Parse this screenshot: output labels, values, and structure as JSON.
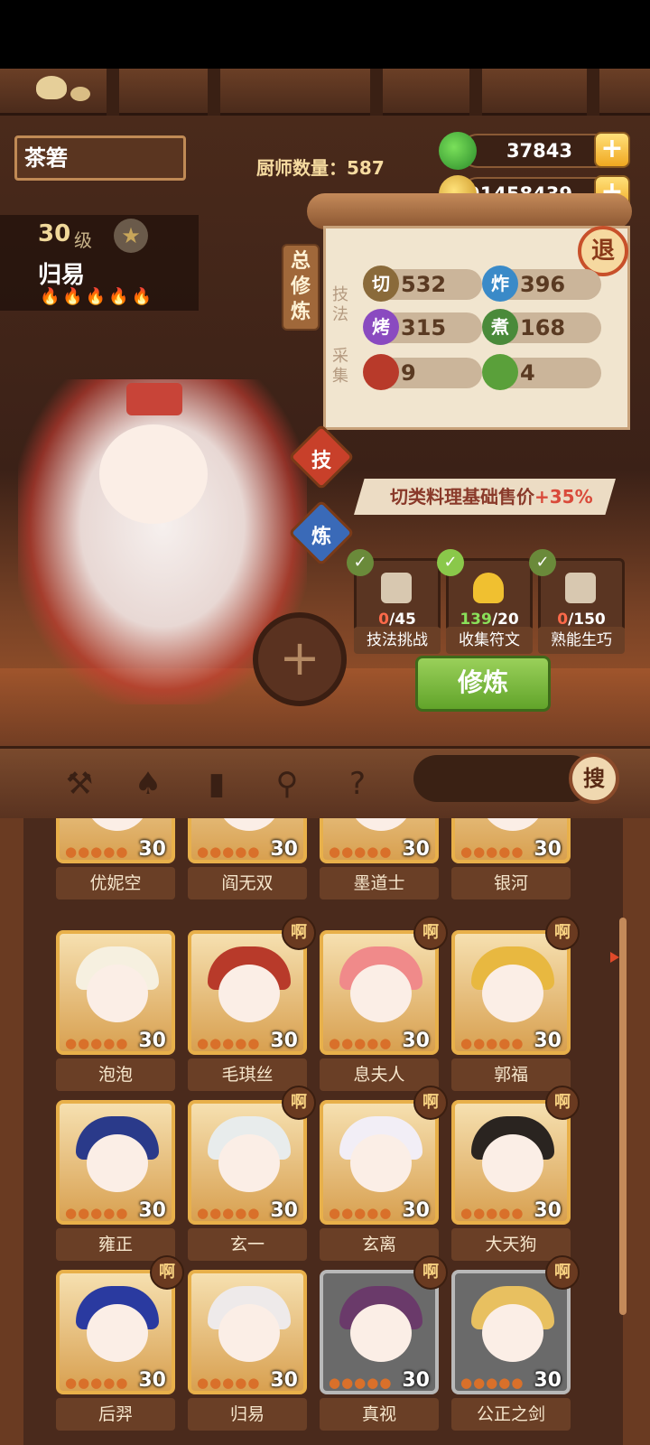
{
  "header": {
    "kitchen_name": "茶箬",
    "chef_count_label": "厨师数量：",
    "chef_count": "587"
  },
  "currency": {
    "jade": "37843",
    "gold": "91458439",
    "plus_glyph": "+"
  },
  "character": {
    "level": "30",
    "level_unit": "级",
    "name": "归易",
    "star_glyph": "★",
    "flames": "🔥🔥🔥🔥🔥"
  },
  "cultivation": {
    "tab_label": "总修炼",
    "back_label": "退",
    "technique_label": "技法",
    "gather_label": "采集",
    "stats": [
      {
        "icon": "切",
        "value": "532",
        "color": "#8a6a3a"
      },
      {
        "icon": "炸",
        "value": "396",
        "color": "#3a8ac8"
      },
      {
        "icon": "烤",
        "value": "315",
        "color": "#8a4ac0"
      },
      {
        "icon": "煮",
        "value": "168",
        "color": "#4a8a3a"
      },
      {
        "icon": "",
        "value": "9",
        "color": "#b83a2a"
      },
      {
        "icon": "",
        "value": "4",
        "color": "#5aa03a"
      }
    ],
    "skill_tab": "技",
    "refine_tab": "炼",
    "bonus_text": "切类料理基础售价",
    "bonus_value": "+35%",
    "tasks": [
      {
        "count": "0",
        "total": "/45",
        "label": "技法挑战",
        "check": "✓"
      },
      {
        "count": "139",
        "total": "/20",
        "label": "收集符文",
        "check": "✓"
      },
      {
        "count": "0",
        "total": "/150",
        "label": "熟能生巧",
        "check": "✓"
      }
    ],
    "cultivate_button": "修炼",
    "add_glyph": "+"
  },
  "toolbar": {
    "search_label": "搜"
  },
  "badge_label": "啊",
  "chefs": [
    {
      "name": "优妮空",
      "level": "30",
      "hair": "#f4b8b0",
      "badge": false,
      "frame": "gold"
    },
    {
      "name": "阎无双",
      "level": "30",
      "hair": "#3ab0b8",
      "badge": false,
      "frame": "gold"
    },
    {
      "name": "墨道士",
      "level": "30",
      "hair": "#b8b0c8",
      "badge": false,
      "frame": "gold"
    },
    {
      "name": "银河",
      "level": "30",
      "hair": "#2a2040",
      "badge": false,
      "frame": "gold"
    },
    {
      "name": "泡泡",
      "level": "30",
      "hair": "#f6f0e0",
      "badge": false,
      "frame": "gold"
    },
    {
      "name": "毛琪丝",
      "level": "30",
      "hair": "#b83a2a",
      "badge": true,
      "frame": "gold"
    },
    {
      "name": "息夫人",
      "level": "30",
      "hair": "#f08a8a",
      "badge": true,
      "frame": "gold"
    },
    {
      "name": "郭福",
      "level": "30",
      "hair": "#e8b840",
      "badge": true,
      "frame": "gold"
    },
    {
      "name": "雍正",
      "level": "30",
      "hair": "#2a3a8a",
      "badge": false,
      "frame": "gold"
    },
    {
      "name": "玄一",
      "level": "30",
      "hair": "#e8ecec",
      "badge": true,
      "frame": "gold"
    },
    {
      "name": "玄离",
      "level": "30",
      "hair": "#f2eef6",
      "badge": true,
      "frame": "gold"
    },
    {
      "name": "大天狗",
      "level": "30",
      "hair": "#2a2420",
      "badge": true,
      "frame": "gold"
    },
    {
      "name": "后羿",
      "level": "30",
      "hair": "#2a3aa0",
      "badge": true,
      "frame": "gold"
    },
    {
      "name": "归易",
      "level": "30",
      "hair": "#eeeaea",
      "badge": false,
      "frame": "gold"
    },
    {
      "name": "真视",
      "level": "30",
      "hair": "#6a3a6a",
      "badge": true,
      "frame": "grey"
    },
    {
      "name": "公正之剑",
      "level": "30",
      "hair": "#e8c060",
      "badge": true,
      "frame": "grey"
    }
  ]
}
